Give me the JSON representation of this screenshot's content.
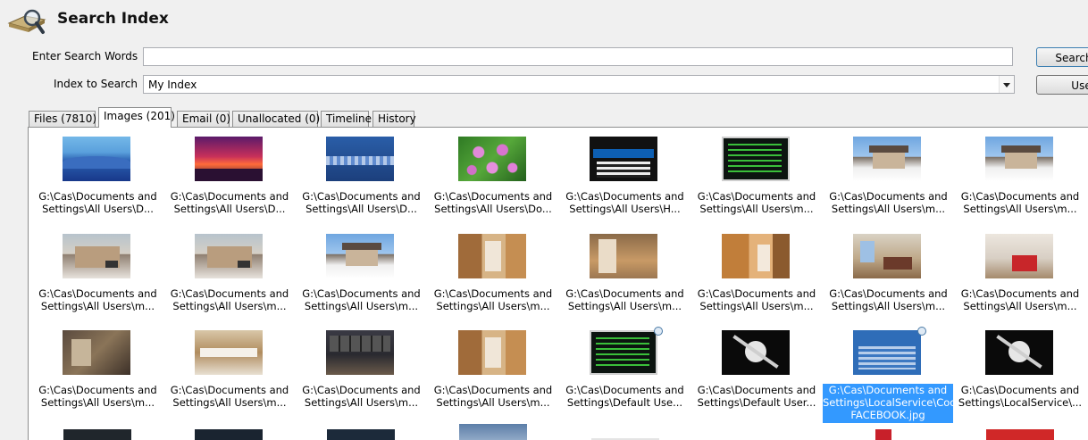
{
  "header": {
    "title": "Search Index",
    "logo_icon": "magnifier-over-book-icon"
  },
  "form": {
    "search_words_label": "Enter Search Words",
    "search_words_value": "",
    "index_label": "Index to Search",
    "index_value": "My Index",
    "search_button": "Search",
    "use_button": "Use"
  },
  "tabs": [
    {
      "label": "Files (7810)",
      "active": false
    },
    {
      "label": "Images (201)",
      "active": true
    },
    {
      "label": "Email (0)",
      "active": false
    },
    {
      "label": "Unallocated (0)",
      "active": false
    },
    {
      "label": "Timeline",
      "active": false
    },
    {
      "label": "History",
      "active": false
    }
  ],
  "images": [
    {
      "line1": "G:\\Cas\\Documents and",
      "line2": "Settings\\All Users\\D...",
      "thumb": "winter-landscape"
    },
    {
      "line1": "G:\\Cas\\Documents and",
      "line2": "Settings\\All Users\\D...",
      "thumb": "sunset"
    },
    {
      "line1": "G:\\Cas\\Documents and",
      "line2": "Settings\\All Users\\D...",
      "thumb": "blue-wave"
    },
    {
      "line1": "G:\\Cas\\Documents and",
      "line2": "Settings\\All Users\\Do...",
      "thumb": "water-lilies"
    },
    {
      "line1": "G:\\Cas\\Documents and",
      "line2": "Settings\\All Users\\H...",
      "thumb": "hacker-facebook-page"
    },
    {
      "line1": "G:\\Cas\\Documents and",
      "line2": "Settings\\All Users\\m...",
      "thumb": "terminal-screen"
    },
    {
      "line1": "G:\\Cas\\Documents and",
      "line2": "Settings\\All Users\\m...",
      "thumb": "house-in-snow"
    },
    {
      "line1": "G:\\Cas\\Documents and",
      "line2": "Settings\\All Users\\m...",
      "thumb": "house-in-snow"
    },
    {
      "line1": "G:\\Cas\\Documents and",
      "line2": "Settings\\All Users\\m...",
      "thumb": "house-exterior"
    },
    {
      "line1": "G:\\Cas\\Documents and",
      "line2": "Settings\\All Users\\m...",
      "thumb": "house-exterior"
    },
    {
      "line1": "G:\\Cas\\Documents and",
      "line2": "Settings\\All Users\\m...",
      "thumb": "house-in-snow"
    },
    {
      "line1": "G:\\Cas\\Documents and",
      "line2": "Settings\\All Users\\m...",
      "thumb": "room-interior"
    },
    {
      "line1": "G:\\Cas\\Documents and",
      "line2": "Settings\\All Users\\m...",
      "thumb": "room-interior"
    },
    {
      "line1": "G:\\Cas\\Documents and",
      "line2": "Settings\\All Users\\m...",
      "thumb": "room-interior"
    },
    {
      "line1": "G:\\Cas\\Documents and",
      "line2": "Settings\\All Users\\m...",
      "thumb": "room-interior"
    },
    {
      "line1": "G:\\Cas\\Documents and",
      "line2": "Settings\\All Users\\m...",
      "thumb": "room-with-red-furniture"
    },
    {
      "line1": "G:\\Cas\\Documents and",
      "line2": "Settings\\All Users\\m...",
      "thumb": "room-interior"
    },
    {
      "line1": "G:\\Cas\\Documents and",
      "line2": "Settings\\All Users\\m...",
      "thumb": "kitchen"
    },
    {
      "line1": "G:\\Cas\\Documents and",
      "line2": "Settings\\All Users\\m...",
      "thumb": "dark-room"
    },
    {
      "line1": "G:\\Cas\\Documents and",
      "line2": "Settings\\All Users\\m...",
      "thumb": "room-interior"
    },
    {
      "line1": "G:\\Cas\\Documents and",
      "line2": "Settings\\Default Use...",
      "thumb": "terminal-screen",
      "badge": true
    },
    {
      "line1": "G:\\Cas\\Documents and",
      "line2": "Settings\\Default User...",
      "thumb": "pirate-skull"
    },
    {
      "line1": "G:\\Cas\\Documents and",
      "line2": "Settings\\LocalService\\Cookies\\HACKER FACEBOOK.jpg",
      "thumb": "hacker-facebook-page",
      "selected": true,
      "badge": true
    },
    {
      "line1": "G:\\Cas\\Documents and",
      "line2": "Settings\\LocalService\\...",
      "thumb": "pirate-skull"
    }
  ],
  "selected_full_caption": "G:\\Cas\\Documents and Settings\\LocalService\\Cookies\\HACKER FACEBOOK.jpg",
  "colors": {
    "selection": "#3399ff",
    "window_bg": "#f0f0f0"
  }
}
